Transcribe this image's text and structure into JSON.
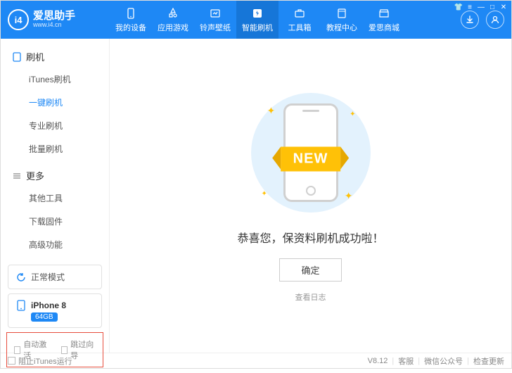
{
  "logo": {
    "badge": "i4",
    "name": "爱思助手",
    "url": "www.i4.cn"
  },
  "nav": [
    {
      "label": "我的设备",
      "icon": "phone"
    },
    {
      "label": "应用游戏",
      "icon": "apps"
    },
    {
      "label": "铃声壁纸",
      "icon": "media"
    },
    {
      "label": "智能刷机",
      "icon": "flash"
    },
    {
      "label": "工具箱",
      "icon": "toolbox"
    },
    {
      "label": "教程中心",
      "icon": "book"
    },
    {
      "label": "爱思商城",
      "icon": "store"
    }
  ],
  "sidebar": {
    "groups": [
      {
        "title": "刷机",
        "icon": "phone",
        "items": [
          "iTunes刷机",
          "一键刷机",
          "专业刷机",
          "批量刷机"
        ],
        "activeIndex": 1
      },
      {
        "title": "更多",
        "icon": "list",
        "items": [
          "其他工具",
          "下载固件",
          "高级功能"
        ]
      }
    ],
    "mode": "正常模式",
    "device": {
      "name": "iPhone 8",
      "storage": "64GB"
    },
    "checks": {
      "auto_activate": "自动激活",
      "skip_guide": "跳过向导"
    }
  },
  "main": {
    "ribbon": "NEW",
    "success": "恭喜您，保资料刷机成功啦！",
    "confirm": "确定",
    "log_link": "查看日志"
  },
  "footer": {
    "block_itunes": "阻止iTunes运行",
    "version": "V8.12",
    "support": "客服",
    "wechat": "微信公众号",
    "update": "检查更新"
  }
}
